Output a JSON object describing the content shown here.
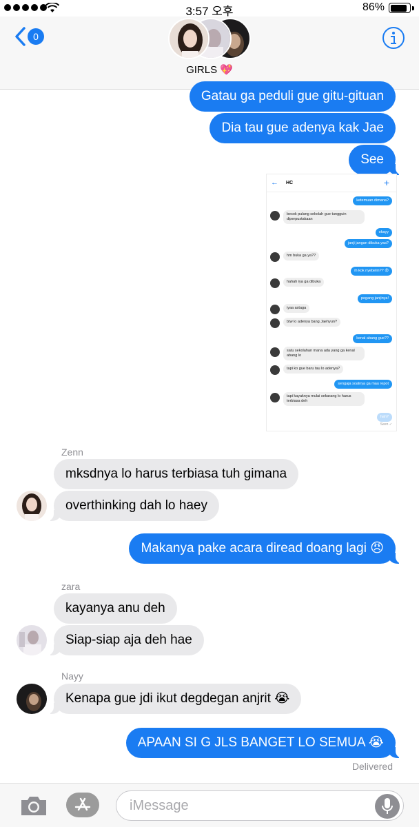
{
  "status_bar": {
    "time": "3:57 오후",
    "battery": "86%",
    "battery_level": 0.86
  },
  "header": {
    "back_count": "0",
    "group_name": "GIRLS 💖",
    "back_icon": "chevron-left-icon",
    "info_icon": "info-icon"
  },
  "messages": [
    {
      "from": "me",
      "text": "Gatau ga peduli gue gitu-gituan"
    },
    {
      "from": "me",
      "text": "Dia tau gue adenya kak Jae"
    },
    {
      "from": "me",
      "text": "See"
    },
    {
      "from": "Zenn",
      "text": "mksdnya lo harus terbiasa tuh gimana"
    },
    {
      "from": "Zenn",
      "text": "overthinking dah lo haey"
    },
    {
      "from": "me",
      "text": "Makanya pake acara diread doang lagi 😠"
    },
    {
      "from": "zara",
      "text": "kayanya anu deh"
    },
    {
      "from": "zara",
      "text": "Siap-siap aja deh hae"
    },
    {
      "from": "Nayy",
      "text": "Kenapa gue jdi ikut degdegan anjrit 😭"
    },
    {
      "from": "me",
      "text": "APAAN SI G JLS BANGET LO SEMUA 😭"
    }
  ],
  "senders": {
    "zenn": "Zenn",
    "zara": "zara",
    "nayy": "Nayy"
  },
  "delivered": "Delivered",
  "screenshot": {
    "title": "HC",
    "seen": "Seen ✓",
    "messages": [
      {
        "side": "out",
        "text": "ketemuan dimana?"
      },
      {
        "side": "in",
        "text": "besok pulang sekolah gue tungguin diperpustakaan"
      },
      {
        "side": "out",
        "text": "okayy"
      },
      {
        "side": "out",
        "text": "janji jangan dibuka yaa?"
      },
      {
        "side": "in",
        "text": "hm buka ga ya??"
      },
      {
        "side": "out",
        "text": "ih kok nyebelin?? 😡"
      },
      {
        "side": "in",
        "text": "hahah iya ga dibuka"
      },
      {
        "side": "out",
        "text": "pegang janjinya!"
      },
      {
        "side": "in",
        "text": "iyaa astaga"
      },
      {
        "side": "in",
        "text": "btw lo adenya bang Jaehyun?"
      },
      {
        "side": "out",
        "text": "kenal abang gue??"
      },
      {
        "side": "in",
        "text": "satu sekolahan mana ada yang ga kenal abang lo"
      },
      {
        "side": "in",
        "text": "tapi ko gue baru tau lo adenya?"
      },
      {
        "side": "out",
        "text": "sengaja soalnya ga mau repot"
      },
      {
        "side": "in",
        "text": "tapi kayaknya mulai sekarang lo harus terbiasa deh"
      },
      {
        "side": "out",
        "text": "hah?"
      }
    ]
  },
  "input": {
    "placeholder": "iMessage",
    "camera_icon": "camera-icon",
    "apps_icon": "app-store-icon",
    "mic_icon": "microphone-icon"
  },
  "colors": {
    "accent": "#1a7cf2",
    "incoming_bubble": "#e9e9eb",
    "secondary_text": "#8e8e93"
  }
}
